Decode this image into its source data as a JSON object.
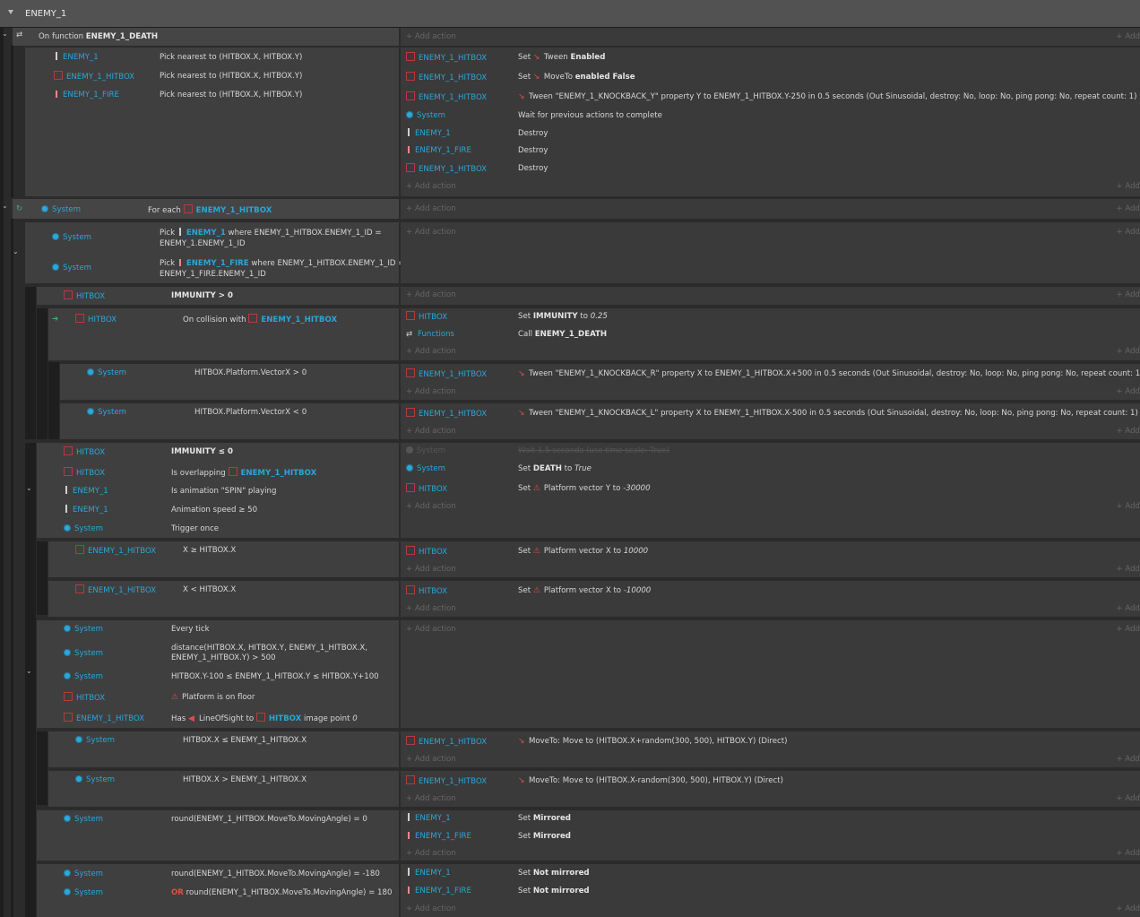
{
  "group_title": "ENEMY_1",
  "add_action": "+ Add action",
  "add_short": "+ Add",
  "ev1": {
    "title_pre": "On function",
    "title_name": "ENEMY_1_DEATH",
    "conds": [
      {
        "obj": "ENEMY_1",
        "text": "Pick nearest to (HITBOX.X, HITBOX.Y)"
      },
      {
        "obj": "ENEMY_1_HITBOX",
        "text": "Pick nearest to (HITBOX.X, HITBOX.Y)"
      },
      {
        "obj": "ENEMY_1_FIRE",
        "text": "Pick nearest to (HITBOX.X, HITBOX.Y)"
      }
    ],
    "acts": [
      {
        "obj": "ENEMY_1_HITBOX",
        "pre": "Set",
        "mid": "Tween",
        "post": "Enabled"
      },
      {
        "obj": "ENEMY_1_HITBOX",
        "pre": "Set",
        "mid": "MoveTo",
        "post": "enabled False"
      },
      {
        "obj": "ENEMY_1_HITBOX",
        "text": "Tween \"ENEMY_1_KNOCKBACK_Y\" property Y to ENEMY_1_HITBOX.Y-250 in 0.5 seconds (Out Sinusoidal, destroy: No, loop: No, ping pong: No, repeat count: 1)"
      },
      {
        "obj": "System",
        "text": "Wait for previous actions to complete"
      },
      {
        "obj": "ENEMY_1",
        "text": "Destroy"
      },
      {
        "obj": "ENEMY_1_FIRE",
        "text": "Destroy"
      },
      {
        "obj": "ENEMY_1_HITBOX",
        "text": "Destroy"
      }
    ]
  },
  "ev2": {
    "obj": "System",
    "pre": "For each",
    "target": "ENEMY_1_HITBOX",
    "picks": [
      {
        "obj": "System",
        "pre": "Pick",
        "target": "ENEMY_1",
        "l1": "where ENEMY_1_HITBOX.ENEMY_1_ID =",
        "l2": "ENEMY_1.ENEMY_1_ID"
      },
      {
        "obj": "System",
        "pre": "Pick",
        "target": "ENEMY_1_FIRE",
        "l1": "where ENEMY_1_HITBOX.ENEMY_1_ID =",
        "l2": "ENEMY_1_FIRE.ENEMY_1_ID"
      }
    ]
  },
  "imm": {
    "obj": "HITBOX",
    "text": "IMMUNITY > 0"
  },
  "coll": {
    "obj": "HITBOX",
    "pre": "On collision with",
    "target": "ENEMY_1_HITBOX",
    "a1_obj": "HITBOX",
    "a1_pre": "Set",
    "a1_b": "IMMUNITY",
    "a1_post": "to",
    "a1_i": "0.25",
    "a2_obj": "Functions",
    "a2_pre": "Call",
    "a2_b": "ENEMY_1_DEATH"
  },
  "vx_pos": {
    "obj": "System",
    "text": "HITBOX.Platform.VectorX > 0",
    "act_obj": "ENEMY_1_HITBOX",
    "act": "Tween \"ENEMY_1_KNOCKBACK_R\" property X to ENEMY_1_HITBOX.X+500 in 0.5 seconds (Out Sinusoidal, destroy: No, loop: No, ping pong: No, repeat count: 1)"
  },
  "vx_neg": {
    "obj": "System",
    "text": "HITBOX.Platform.VectorX < 0",
    "act_obj": "ENEMY_1_HITBOX",
    "act": "Tween \"ENEMY_1_KNOCKBACK_L\" property X to ENEMY_1_HITBOX.X-500 in 0.5 seconds (Out Sinusoidal, destroy: No, loop: No, ping pong: No, repeat count: 1)"
  },
  "imm0": {
    "conds": [
      {
        "obj": "HITBOX",
        "text": "IMMUNITY ≤ 0"
      },
      {
        "obj": "HITBOX",
        "text": "Is overlapping",
        "target": "ENEMY_1_HITBOX"
      },
      {
        "obj": "ENEMY_1",
        "text": "Is animation \"SPIN\" playing"
      },
      {
        "obj": "ENEMY_1",
        "text": "Animation speed ≥ 50"
      },
      {
        "obj": "System",
        "text": "Trigger once"
      }
    ],
    "acts": [
      {
        "obj": "System",
        "text": "Wait 1.5 seconds (use time scale: True)"
      },
      {
        "obj": "System",
        "pre": "Set",
        "b": "DEATH",
        "post": "to",
        "i": "True"
      },
      {
        "obj": "HITBOX",
        "pre": "Set",
        "mid": "Platform vector Y to",
        "i": "-30000"
      }
    ]
  },
  "xge": {
    "obj": "ENEMY_1_HITBOX",
    "text": "X ≥ HITBOX.X",
    "act_obj": "HITBOX",
    "pre": "Set",
    "mid": "Platform vector X to",
    "i": "10000"
  },
  "xlt": {
    "obj": "ENEMY_1_HITBOX",
    "text": "X < HITBOX.X",
    "act_obj": "HITBOX",
    "pre": "Set",
    "mid": "Platform vector X to",
    "i": "-10000"
  },
  "tick": {
    "conds": [
      {
        "obj": "System",
        "text": "Every tick"
      },
      {
        "obj": "System",
        "l1": "distance(HITBOX.X, HITBOX.Y, ENEMY_1_HITBOX.X,",
        "l2": "ENEMY_1_HITBOX.Y) > 500"
      },
      {
        "obj": "System",
        "text": "HITBOX.Y-100 ≤ ENEMY_1_HITBOX.Y ≤ HITBOX.Y+100"
      },
      {
        "obj": "HITBOX",
        "text": "Platform is on floor"
      },
      {
        "obj": "ENEMY_1_HITBOX",
        "pre": "Has",
        "mid": "LineOfSight to",
        "target": "HITBOX",
        "post": "image point",
        "i": "0"
      }
    ]
  },
  "mv1": {
    "obj": "System",
    "text": "HITBOX.X ≤ ENEMY_1_HITBOX.X",
    "act_obj": "ENEMY_1_HITBOX",
    "act": "MoveTo: Move to (HITBOX.X+random(300, 500), HITBOX.Y) (Direct)"
  },
  "mv2": {
    "obj": "System",
    "text": "HITBOX.X > ENEMY_1_HITBOX.X",
    "act_obj": "ENEMY_1_HITBOX",
    "act": "MoveTo: Move to (HITBOX.X-random(300, 500), HITBOX.Y) (Direct)"
  },
  "ang0": {
    "obj": "System",
    "text": "round(ENEMY_1_HITBOX.MoveTo.MovingAngle) = 0",
    "acts": [
      {
        "obj": "ENEMY_1",
        "pre": "Set",
        "b": "Mirrored"
      },
      {
        "obj": "ENEMY_1_FIRE",
        "pre": "Set",
        "b": "Mirrored"
      }
    ]
  },
  "ang180": {
    "c1_obj": "System",
    "c1": "round(ENEMY_1_HITBOX.MoveTo.MovingAngle) = -180",
    "c2_obj": "System",
    "c2_or": "OR",
    "c2": "round(ENEMY_1_HITBOX.MoveTo.MovingAngle) = 180",
    "acts": [
      {
        "obj": "ENEMY_1",
        "pre": "Set",
        "b": "Not mirrored"
      },
      {
        "obj": "ENEMY_1_FIRE",
        "pre": "Set",
        "b": "Not mirrored"
      }
    ]
  }
}
